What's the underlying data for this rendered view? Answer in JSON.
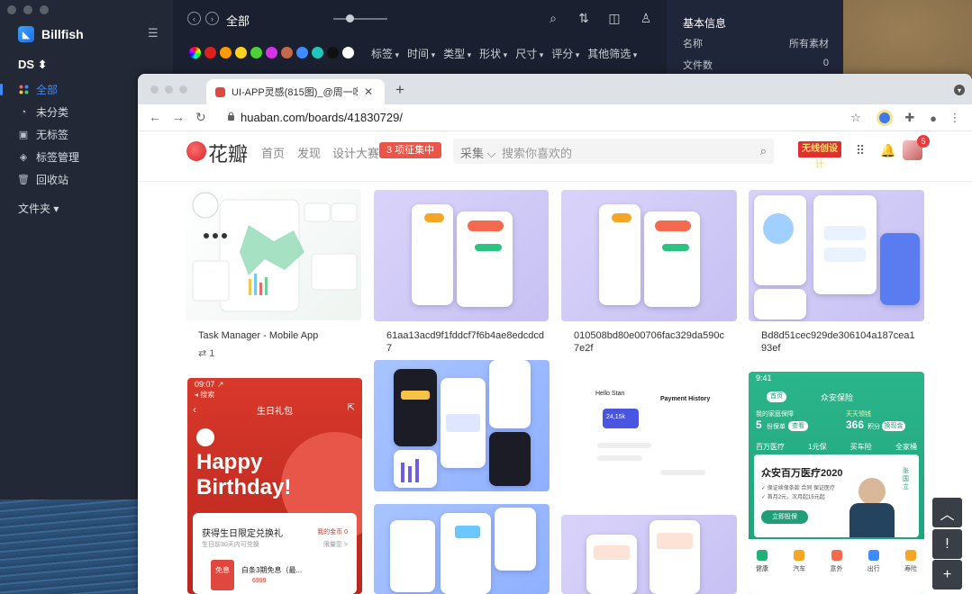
{
  "billfish": {
    "app_name": "Billfish",
    "library": "DS ⬍",
    "nav": [
      {
        "label": "全部",
        "icon": "all-icon",
        "active": true
      },
      {
        "label": "未分类",
        "icon": "pie-icon",
        "active": false
      },
      {
        "label": "无标签",
        "icon": "tag-off-icon",
        "active": false
      },
      {
        "label": "标签管理",
        "icon": "tag-manage-icon",
        "active": false
      },
      {
        "label": "回收站",
        "icon": "trash-icon",
        "active": false
      }
    ],
    "folder_label": "文件夹 ▾",
    "toolbar_title": "全部",
    "colors": [
      "#ffffff",
      "#e02020",
      "#ff9a00",
      "#ffd21f",
      "#4cd137",
      "#d633e6",
      "#c46a4c",
      "#3d8bff",
      "#1fc7b8",
      "#111111",
      "#ffffff"
    ],
    "filters": [
      "标签",
      "时间",
      "类型",
      "形状",
      "尺寸",
      "评分",
      "其他筛选"
    ],
    "info": {
      "title": "基本信息",
      "rows": [
        {
          "label": "名称",
          "value": "所有素材"
        },
        {
          "label": "文件数",
          "value": "0"
        }
      ]
    }
  },
  "browser": {
    "tab_title": "UI-APP灵感(815图)_@周一呀收",
    "url": "huaban.com/boards/41830729/"
  },
  "huaban": {
    "logo": "花瓣",
    "nav": [
      "首页",
      "发现",
      "设计大赛"
    ],
    "badge": "3 项征集中",
    "search_category": "采集",
    "search_placeholder": "搜索你喜欢的",
    "ad_text": "无线创设计",
    "notif_count": "5",
    "pins": [
      {
        "title": "Task Manager - Mobile App",
        "count": "1"
      },
      {
        "title": "61aa13acd9f1fddcf7f6b4ae8edcdcd7"
      },
      {
        "title": "010508bd80e00706fac329da590c7e2f"
      },
      {
        "title": "Bd8d51cec929de306104a187cea193ef"
      }
    ],
    "birthday": {
      "time": "09:07 ↗",
      "back": "◂ 搜索",
      "header": "生日礼包",
      "headline1": "Happy",
      "headline2": "Birthday!",
      "card_title": "获得生日限定兑换礼",
      "card_link": "我的金币 0",
      "card_sub": "生日前30天内可兑换",
      "card_sub_right": "限量至 >",
      "item_tag": "免息",
      "item_label": "白条3期免息（最...",
      "item_price": "6999"
    },
    "insurance": {
      "time": "9:41",
      "btn": "首页",
      "brand": "众安保险",
      "stat1_label": "我的家庭保障",
      "stat1_value": "5",
      "stat1_unit": "份保单",
      "stat1_btn": "查看",
      "stat2_label": "天天领钱",
      "stat2_value": "366",
      "stat2_unit": "积分",
      "stat2_btn": "换现金",
      "tabs": [
        "百万医疗",
        "1元保",
        "买车险",
        "全家桶"
      ],
      "banner_title": "众安百万医疗2020",
      "banner_p1": "✓ 保证续保条款 合同 保证医疗",
      "banner_p2": "✓ 首月2元，次月起15元起",
      "banner_btn": "立即投保",
      "person": "张国立",
      "icons": [
        "健康",
        "汽车",
        "意外",
        "出行",
        "寿险"
      ]
    },
    "payment": {
      "hello": "Hello Stan",
      "title": "Payment History",
      "amount": "24,15k"
    }
  },
  "fabs": [
    "︿",
    "!",
    "+"
  ]
}
